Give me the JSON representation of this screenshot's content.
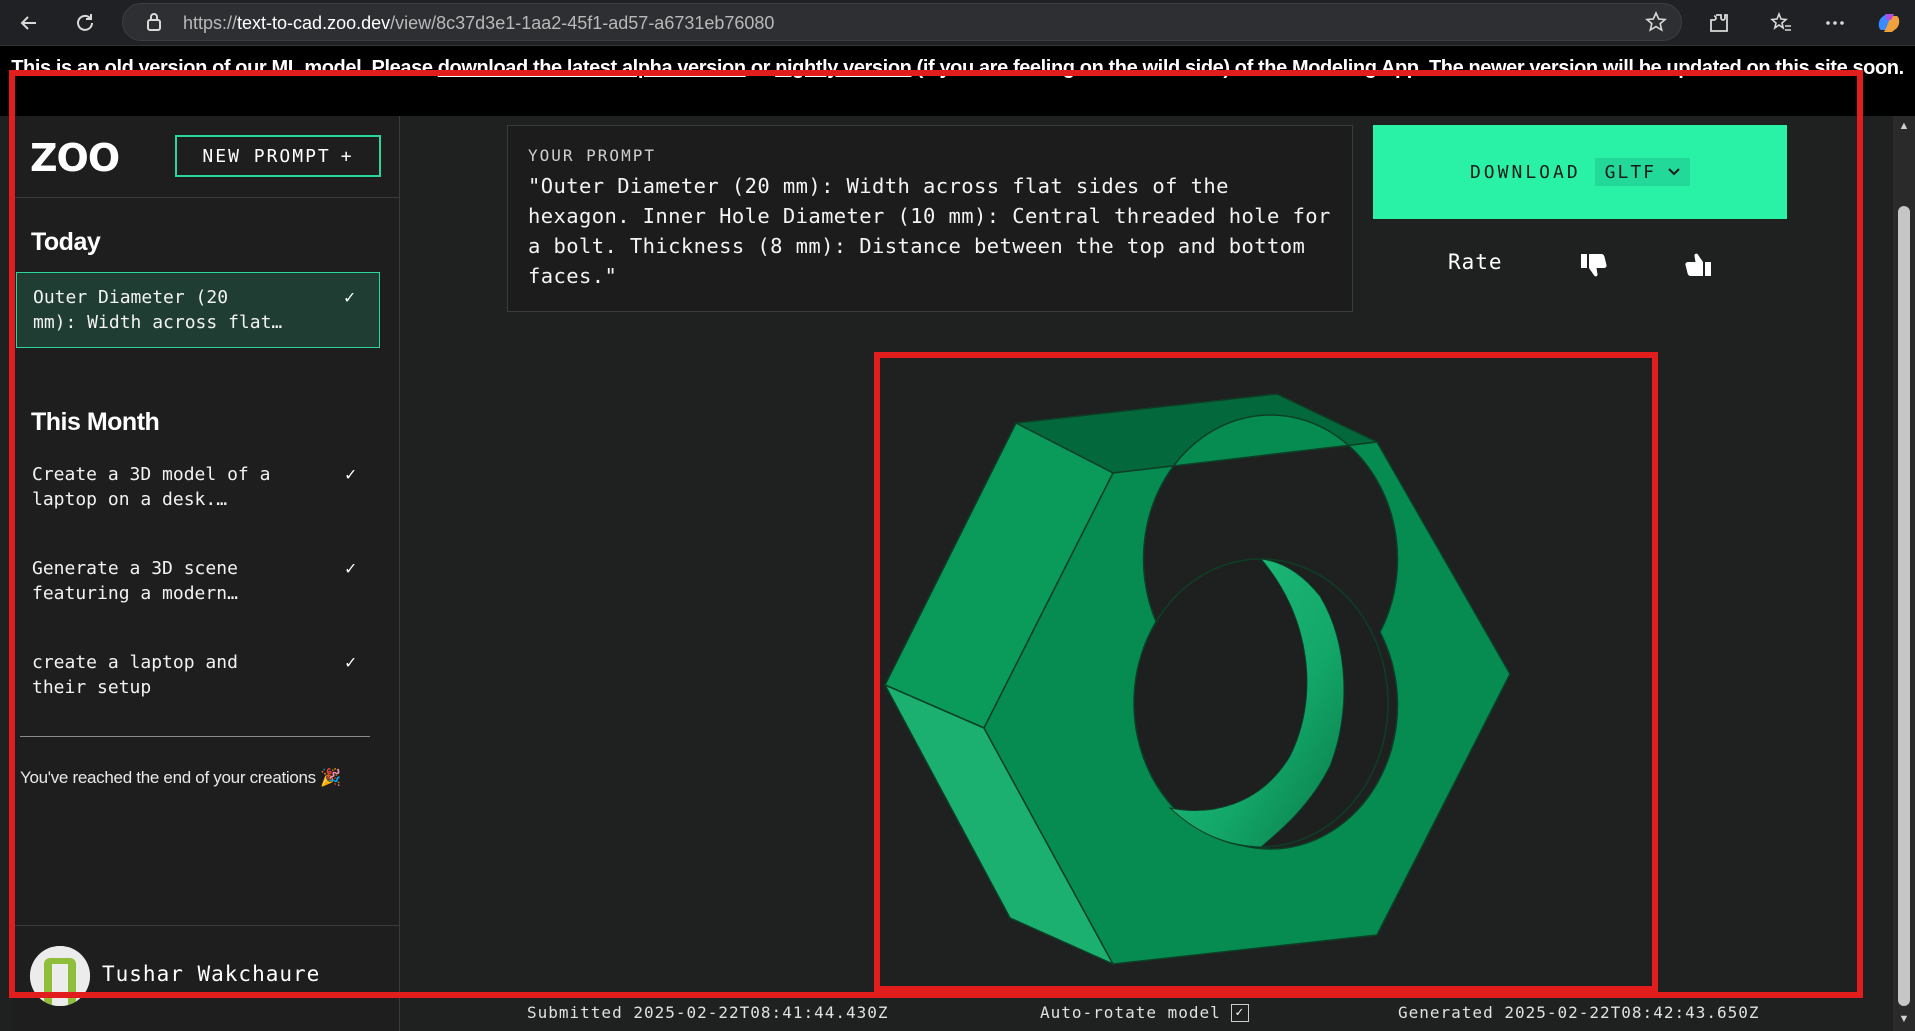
{
  "browser": {
    "url_prefix": "https://",
    "url_host": "text-to-cad.zoo.dev",
    "url_path": "/view/8c37d3e1-1aa2-45f1-ad57-a6731eb76080"
  },
  "banner": {
    "text_1": "This is an old version of our ML model. Please ",
    "link_1": "download the latest alpha version",
    "text_2": " or ",
    "link_2": "nightly version",
    "text_3": " (if you are feeling on the wild side) of the Modeling App. The newer version will be updated on this site soon."
  },
  "sidebar": {
    "logo": "ZOO",
    "new_prompt_label": "NEW PROMPT",
    "new_prompt_icon": "+",
    "today_title": "Today",
    "today_items": [
      {
        "label_line1": "Outer Diameter (20",
        "label_line2": "mm): Width across flat…",
        "check": "✓"
      }
    ],
    "month_title": "This Month",
    "month_items": [
      {
        "label_line1": "Create a 3D model of a",
        "label_line2": "laptop on a desk.…",
        "check": "✓"
      },
      {
        "label_line1": "Generate a 3D scene",
        "label_line2": "featuring a modern…",
        "check": "✓"
      },
      {
        "label_line1": "create a laptop and",
        "label_line2": "their setup",
        "check": "✓"
      }
    ],
    "end_note": "You've reached the end of your creations 🎉",
    "user_name": "Tushar Wakchaure"
  },
  "prompt": {
    "label": "YOUR PROMPT",
    "text": "\"Outer Diameter (20 mm): Width across flat sides of the hexagon. Inner Hole Diameter (10 mm): Central threaded hole for a bolt. Thickness (8 mm): Distance between the top and bottom faces.\""
  },
  "download": {
    "label": "DOWNLOAD",
    "format": "GLTF"
  },
  "rating": {
    "label": "Rate"
  },
  "footer": {
    "submitted": "Submitted 2025-02-22T08:41:44.430Z",
    "autorotate_label": "Auto-rotate model",
    "autorotate_checked": "✓",
    "generated": "Generated 2025-02-22T08:42:43.650Z"
  },
  "colors": {
    "accent": "#29f2a6",
    "model_green": "#0b8f54",
    "annotation_red": "#e21d1d"
  }
}
